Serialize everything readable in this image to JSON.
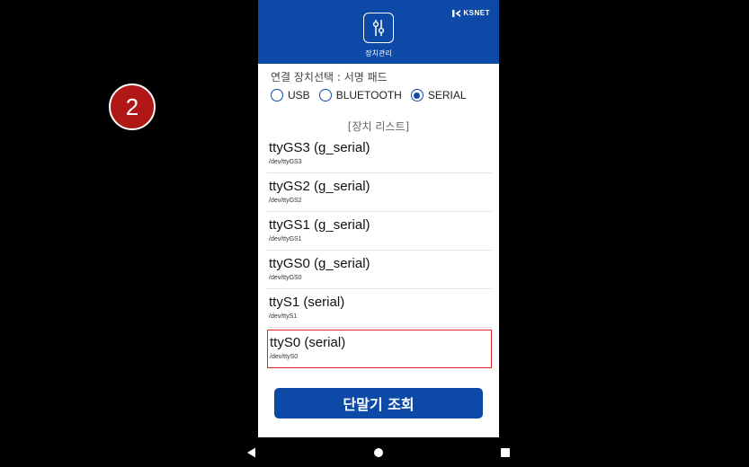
{
  "step_badge": "2",
  "header": {
    "brand": "KSNET",
    "device_mgmt_label": "장치관리",
    "icon": "settings-sliders-icon"
  },
  "connection": {
    "label": "연결 장치선택 : 서명 패드",
    "options": [
      {
        "label": "USB",
        "selected": false
      },
      {
        "label": "BLUETOOTH",
        "selected": false
      },
      {
        "label": "SERIAL",
        "selected": true
      }
    ]
  },
  "device_list": {
    "title": "[장치 리스트]",
    "items": [
      {
        "name": "ttyGS3 (g_serial)",
        "path": "/dev/ttyGS3",
        "selected": false
      },
      {
        "name": "ttyGS2 (g_serial)",
        "path": "/dev/ttyGS2",
        "selected": false
      },
      {
        "name": "ttyGS1 (g_serial)",
        "path": "/dev/ttyGS1",
        "selected": false
      },
      {
        "name": "ttyGS0 (g_serial)",
        "path": "/dev/ttyGS0",
        "selected": false
      },
      {
        "name": "ttyS1 (serial)",
        "path": "/dev/ttyS1",
        "selected": false
      },
      {
        "name": "ttyS0 (serial)",
        "path": "/dev/ttyS0",
        "selected": true
      }
    ]
  },
  "query_button": "단말기 조회",
  "nav": {
    "back_icon": "back-triangle-icon",
    "home_icon": "home-circle-icon",
    "recents_icon": "recents-square-icon"
  },
  "colors": {
    "primary": "#0d4aa8",
    "highlight": "#e0262b",
    "badge": "#b01818"
  }
}
